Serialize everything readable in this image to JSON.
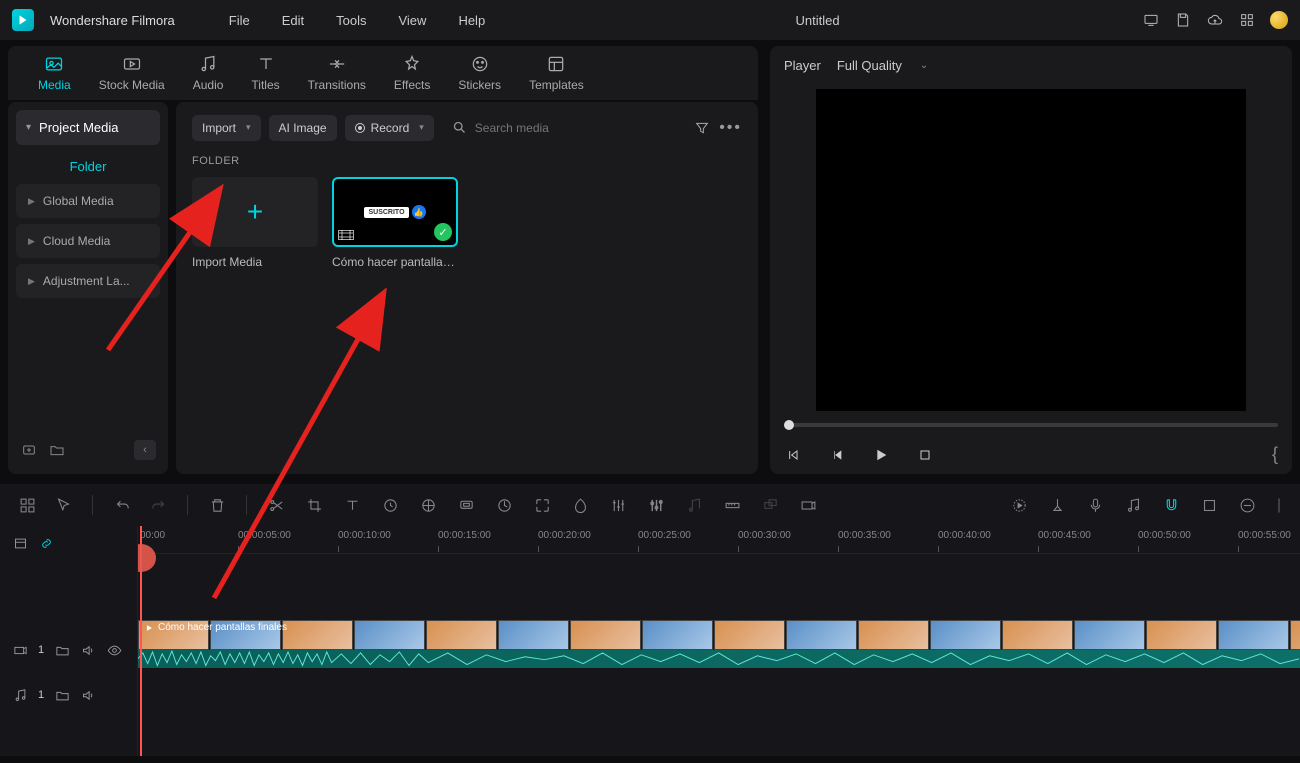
{
  "app": {
    "name": "Wondershare Filmora",
    "docTitle": "Untitled"
  },
  "menu": [
    "File",
    "Edit",
    "Tools",
    "View",
    "Help"
  ],
  "tabs": [
    {
      "label": "Media",
      "active": true
    },
    {
      "label": "Stock Media",
      "active": false
    },
    {
      "label": "Audio",
      "active": false
    },
    {
      "label": "Titles",
      "active": false
    },
    {
      "label": "Transitions",
      "active": false
    },
    {
      "label": "Effects",
      "active": false
    },
    {
      "label": "Stickers",
      "active": false
    },
    {
      "label": "Templates",
      "active": false
    }
  ],
  "sidebar": {
    "project": "Project Media",
    "folder": "Folder",
    "items": [
      "Global Media",
      "Cloud Media",
      "Adjustment La..."
    ]
  },
  "toolbar": {
    "import": "Import",
    "aiImage": "AI Image",
    "record": "Record",
    "searchPlaceholder": "Search media"
  },
  "content": {
    "folderHeader": "FOLDER",
    "importMedia": "Import Media",
    "clipName": "Cómo hacer pantallas ...",
    "suscrito": "SUSCRITO"
  },
  "player": {
    "label": "Player",
    "quality": "Full Quality"
  },
  "ruler": [
    "00:00",
    "00:00:05:00",
    "00:00:10:00",
    "00:00:15:00",
    "00:00:20:00",
    "00:00:25:00",
    "00:00:30:00",
    "00:00:35:00",
    "00:00:40:00",
    "00:00:45:00",
    "00:00:50:00",
    "00:00:55:00"
  ],
  "tracks": {
    "video": "1",
    "audio": "1",
    "clipTitle": "Cómo hacer pantallas finales"
  }
}
